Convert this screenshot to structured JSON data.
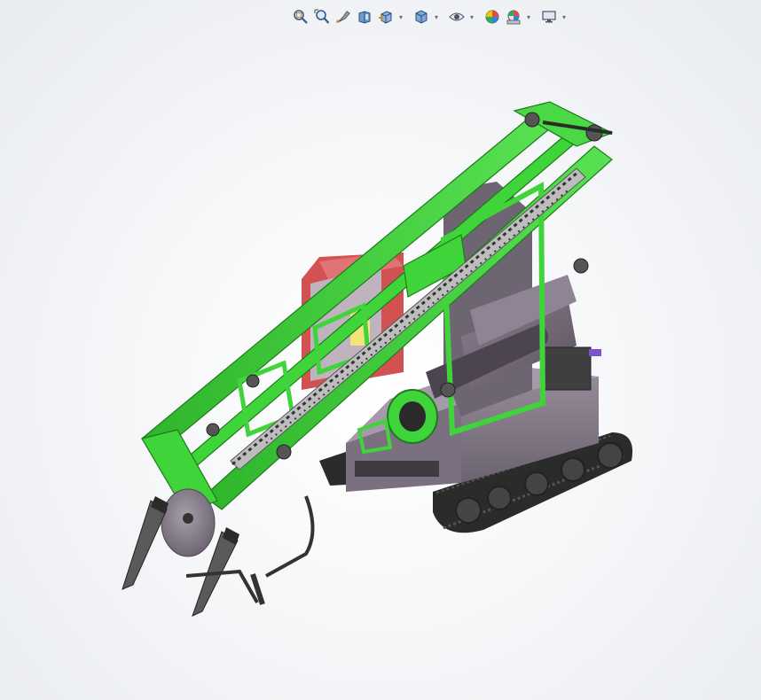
{
  "window": {
    "title": ""
  },
  "toolbar": {
    "items": [
      {
        "id": "zoom-to-fit",
        "icon": "zoom-to-fit-icon",
        "has_dropdown": false
      },
      {
        "id": "zoom-to-area",
        "icon": "zoom-to-area-icon",
        "has_dropdown": false
      },
      {
        "id": "previous-view",
        "icon": "previous-view-icon",
        "has_dropdown": false
      },
      {
        "id": "section-view",
        "icon": "section-view-icon",
        "has_dropdown": false
      },
      {
        "id": "view-orientation",
        "icon": "view-orientation-icon",
        "has_dropdown": true
      },
      {
        "id": "display-style",
        "icon": "display-style-icon",
        "has_dropdown": true
      },
      {
        "id": "hide-show-items",
        "icon": "hide-show-items-icon",
        "has_dropdown": true
      },
      {
        "id": "edit-appearance",
        "icon": "edit-appearance-icon",
        "has_dropdown": false
      },
      {
        "id": "apply-scene",
        "icon": "apply-scene-icon",
        "has_dropdown": true
      },
      {
        "id": "view-settings",
        "icon": "view-settings-icon",
        "has_dropdown": true
      }
    ]
  },
  "model": {
    "description_icon": "3d-model-crawler-machine",
    "colors": {
      "frame": "#3fd43a",
      "frame_dark": "#1f7a1c",
      "body": "#7a6e7e",
      "body_dark": "#4b444e",
      "track": "#3a3a3a",
      "cab": "#c84a4a",
      "disc": "#8e8690",
      "pipe": "#2f2f2f"
    }
  }
}
